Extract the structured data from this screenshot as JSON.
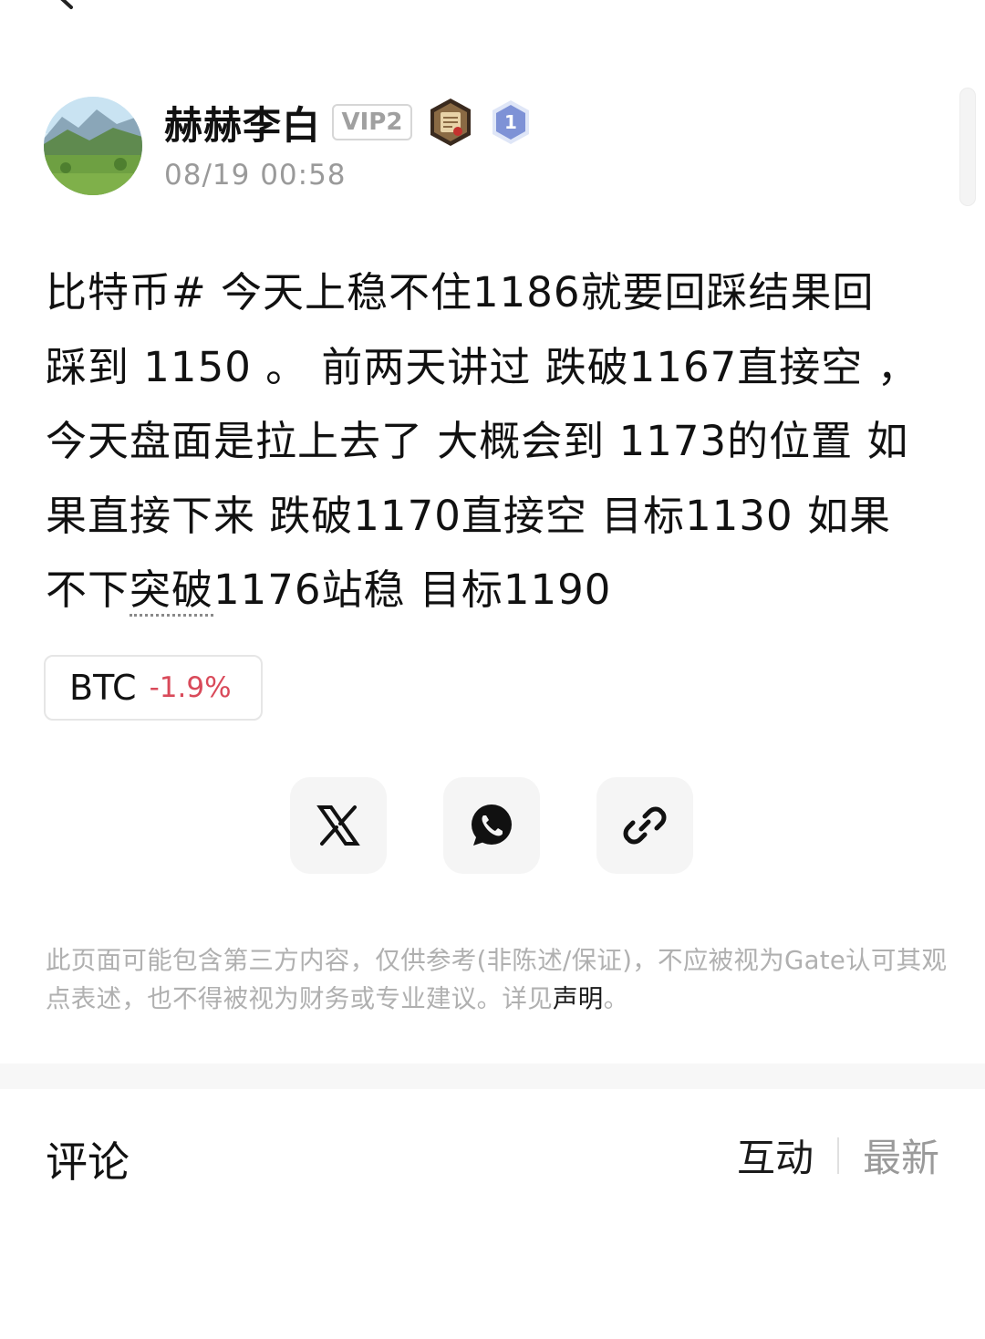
{
  "author": {
    "name": "赫赫李白",
    "vip": "VIP2",
    "time": "08/19 00:58",
    "level": "1"
  },
  "post": {
    "lines": [
      "比特币# 今天上稳不住1186就要回踩结果回",
      "踩到 1150 。 前两天讲过 跌破1167直接空 ，",
      "今天盘面是拉上去了 大概会到 1173的位置  如",
      "果直接下来 跌破1170直接空 目标1130 如果"
    ],
    "last_line_before": "不下",
    "last_line_dotted": "突破",
    "last_line_after": "1176站稳 目标1190"
  },
  "ticker": {
    "symbol": "BTC",
    "change": "-1.9%",
    "change_color": "#d94a5a"
  },
  "share": {
    "icons": [
      "x-logo-icon",
      "whatsapp-icon",
      "link-icon"
    ]
  },
  "disclaimer": {
    "text": "此页面可能包含第三方内容，仅供参考(非陈述/保证)，不应被视为Gate认可其观点表述，也不得被视为财务或专业建议。详见",
    "link": "声明",
    "suffix": "。"
  },
  "comments": {
    "title": "评论",
    "sort_active": "互动",
    "sort_inactive": "最新"
  }
}
